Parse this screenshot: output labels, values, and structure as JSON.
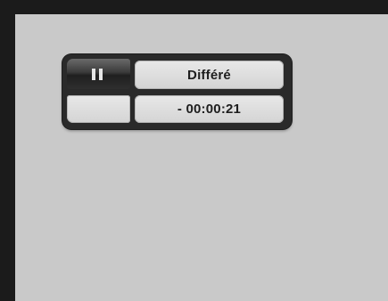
{
  "osd": {
    "pause_icon": "pause-icon",
    "mode_label": "Différé",
    "time_offset": "- 00:00:21"
  },
  "colors": {
    "frame": "#1b1b1b",
    "screen": "#c9c9c9",
    "panel": "#2a2a2a",
    "cell": "#d9d9d9",
    "text": "#1e1e1e"
  }
}
